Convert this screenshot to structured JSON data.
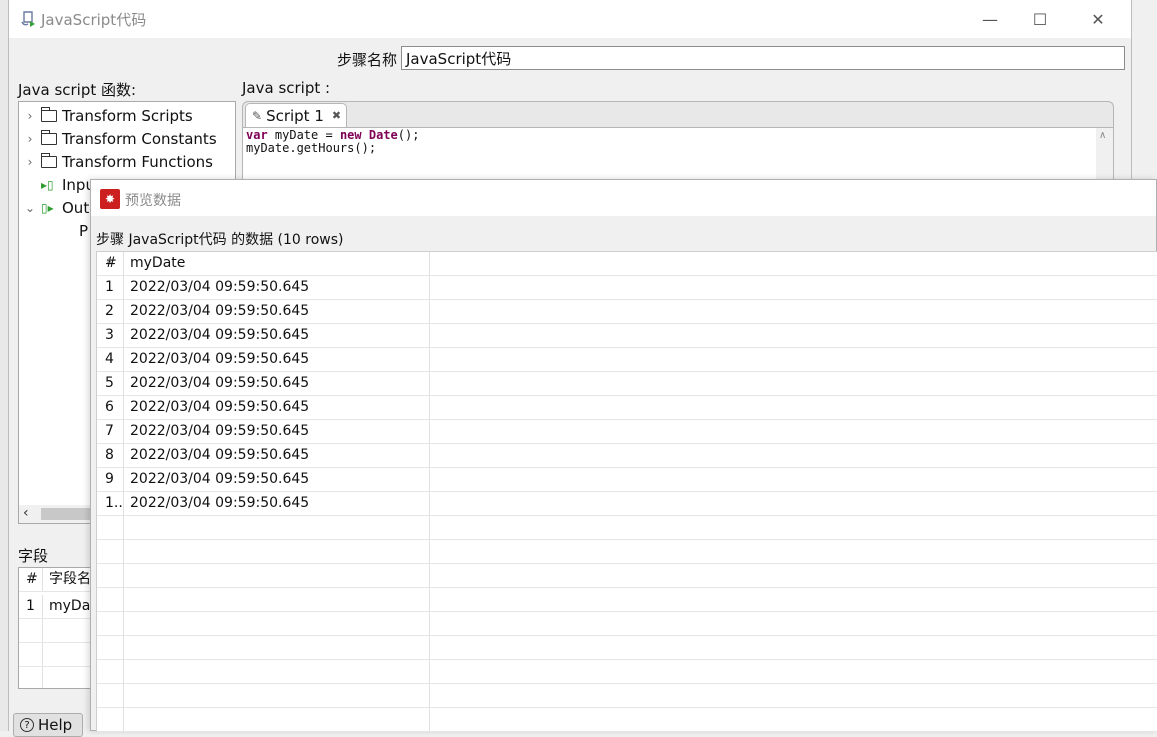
{
  "window": {
    "title": "JavaScript代码",
    "controls": {
      "minimize": "—",
      "maximize": "☐",
      "close": "✕"
    }
  },
  "step": {
    "label": "步骤名称",
    "value": "JavaScript代码"
  },
  "functions_panel": {
    "label": "Java script 函数:",
    "items": [
      {
        "label": "Transform Scripts",
        "icon": "folder-icon",
        "expanded": false
      },
      {
        "label": "Transform Constants",
        "icon": "folder-icon",
        "expanded": false
      },
      {
        "label": "Transform Functions",
        "icon": "folder-icon",
        "expanded": false
      },
      {
        "label": "Inpu",
        "icon": "input-fields-icon",
        "expanded": false
      },
      {
        "label": "Outp",
        "icon": "output-fields-icon",
        "expanded": true
      },
      {
        "label": "P",
        "icon": "none",
        "expanded": false
      }
    ]
  },
  "script_panel": {
    "label": "Java script :",
    "tab_label": "Script 1",
    "code_line1": {
      "kw1": "var",
      "mid1": " myDate = ",
      "kw2": "new",
      "sp": " ",
      "cls": "Date",
      "end": "();"
    },
    "code_line2": "myDate.getHours();"
  },
  "fields_panel": {
    "label": "字段",
    "header_index": "#",
    "header_name": "字段名",
    "rows": [
      {
        "index": "1",
        "name": "myDa"
      }
    ]
  },
  "help_button": {
    "label": "Help",
    "icon": "help-icon"
  },
  "preview": {
    "title": "预览数据",
    "subtitle": "步骤 JavaScript代码 的数据  (10 rows)",
    "columns": [
      "#",
      "myDate"
    ],
    "rows": [
      {
        "index": "1",
        "value": "2022/03/04 09:59:50.645"
      },
      {
        "index": "2",
        "value": "2022/03/04 09:59:50.645"
      },
      {
        "index": "3",
        "value": "2022/03/04 09:59:50.645"
      },
      {
        "index": "4",
        "value": "2022/03/04 09:59:50.645"
      },
      {
        "index": "5",
        "value": "2022/03/04 09:59:50.645"
      },
      {
        "index": "6",
        "value": "2022/03/04 09:59:50.645"
      },
      {
        "index": "7",
        "value": "2022/03/04 09:59:50.645"
      },
      {
        "index": "8",
        "value": "2022/03/04 09:59:50.645"
      },
      {
        "index": "9",
        "value": "2022/03/04 09:59:50.645"
      },
      {
        "index": "1..",
        "value": "2022/03/04 09:59:50.645"
      }
    ],
    "colors": {
      "icon_bg": "#cc1f1f"
    }
  }
}
